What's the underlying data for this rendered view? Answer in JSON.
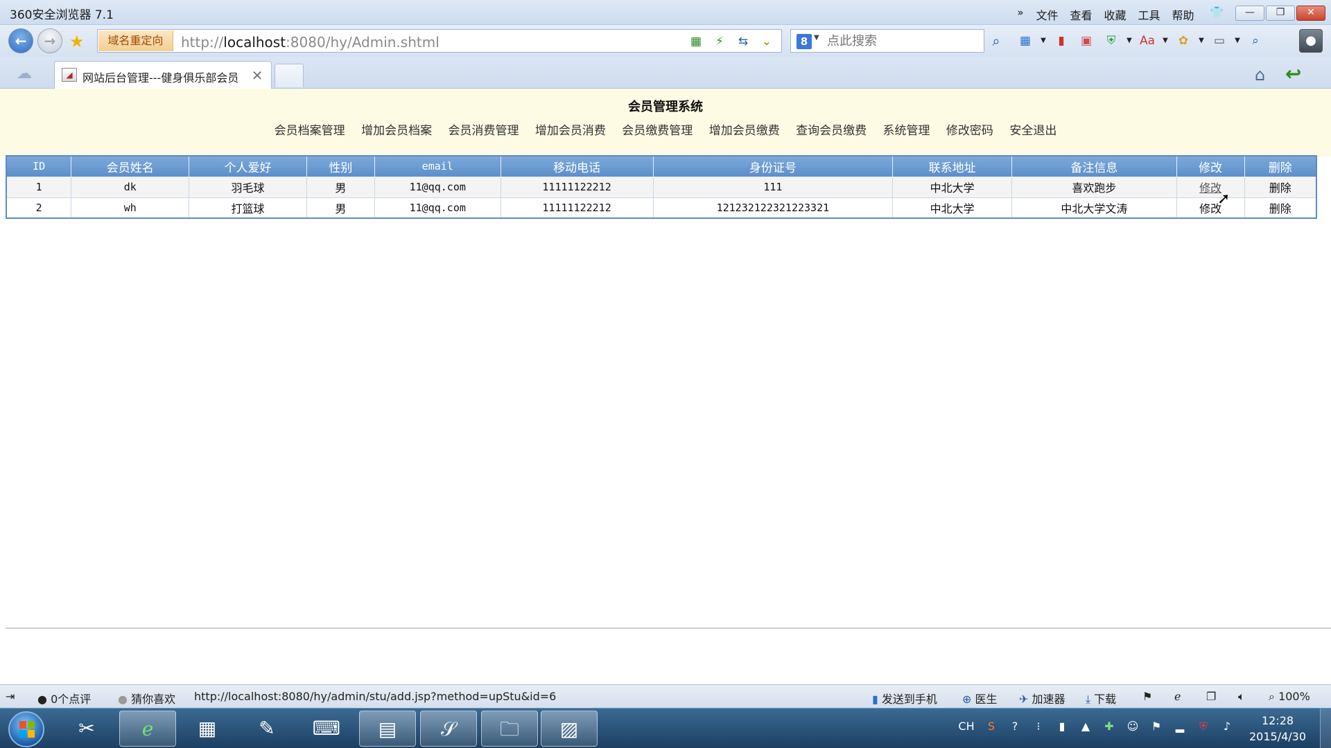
{
  "window": {
    "title": "360安全浏览器 7.1",
    "menus": [
      "文件",
      "查看",
      "收藏",
      "工具",
      "帮助"
    ],
    "menu_more": "»"
  },
  "address_bar": {
    "redirect_label": "域名重定向",
    "url_prefix": "http://",
    "url_host": "localhost",
    "url_rest": ":8080/hy/Admin.shtml",
    "search_placeholder": "点此搜索"
  },
  "tabs": [
    {
      "label": "网站后台管理---健身俱乐部会员",
      "active": true
    }
  ],
  "page": {
    "system_title": "会员管理系统",
    "nav": [
      "会员档案管理",
      "增加会员档案",
      "会员消费管理",
      "增加会员消费",
      "会员缴费管理",
      "增加会员缴费",
      "查询会员缴费",
      "系统管理",
      "修改密码",
      "安全退出"
    ],
    "table": {
      "headers": [
        "ID",
        "会员姓名",
        "个人爱好",
        "性别",
        "email",
        "移动电话",
        "身份证号",
        "联系地址",
        "备注信息",
        "修改",
        "删除"
      ],
      "rows": [
        [
          "1",
          "dk",
          "羽毛球",
          "男",
          "11@qq.com",
          "11111122212",
          "111",
          "中北大学",
          "喜欢跑步",
          "修改",
          "删除"
        ],
        [
          "2",
          "wh",
          "打篮球",
          "男",
          "11@qq.com",
          "11111122212",
          "121232122321223321",
          "中北大学",
          "中北大学文涛",
          "修改",
          "删除"
        ]
      ]
    }
  },
  "status_bar": {
    "comments": "0个点评",
    "guess": "猜你喜欢",
    "hover_url": "http://localhost:8080/hy/admin/stu/add.jsp?method=upStu&id=6",
    "send_phone": "发送到手机",
    "doctor": "医生",
    "accelerator": "加速器",
    "download": "下载",
    "zoom": "100%"
  },
  "taskbar": {
    "ime": "CH",
    "time": "12:28",
    "date": "2015/4/30"
  }
}
